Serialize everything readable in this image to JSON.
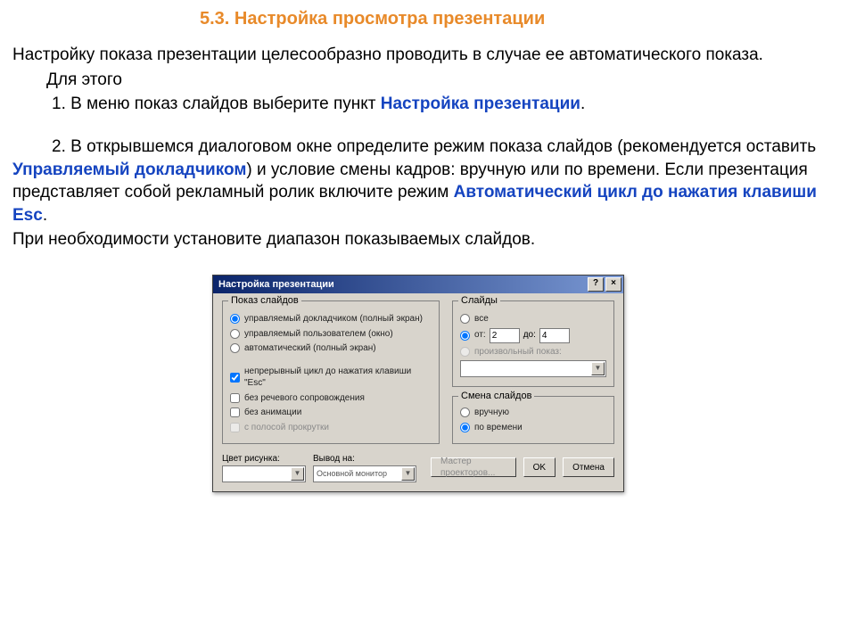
{
  "heading": "5.3.  Настройка просмотра презентации",
  "p1": "Настройку показа презентации целесообразно проводить в случае ее автоматического показа.",
  "p2": "Для этого",
  "p3a": "1.  В меню показ слайдов выберите пункт ",
  "p3term": "Настройка презентации",
  "p3b": ".",
  "p4a": "2.  В открывшемся диалоговом окне определите режим показа слайдов (рекомендуется оставить ",
  "p4term1": "Управляемый докладчиком",
  "p4b": ") и условие смены кадров: вручную или по времени. Если презентация представляет собой рекламный ролик включите режим ",
  "p4term2": "Автоматический цикл до нажатия клавиши Esc",
  "p4c": ".",
  "p5": "При необходимости установите диапазон  показываемых слайдов.",
  "dialog": {
    "title": "Настройка презентации",
    "help": "?",
    "close": "×",
    "group_show": "Показ слайдов",
    "opt1": "управляемый докладчиком (полный экран)",
    "opt2": "управляемый пользователем (окно)",
    "opt3": "автоматический (полный экран)",
    "chk1": "непрерывный цикл до нажатия клавиши \"Esc\"",
    "chk2": "без речевого сопровождения",
    "chk3": "без анимации",
    "chk4": "с полосой прокрутки",
    "group_slides": "Слайды",
    "slides_all": "все",
    "slides_from": "от:",
    "slides_to": "до:",
    "from_val": "2",
    "to_val": "4",
    "slides_custom": "произвольный показ:",
    "group_change": "Смена слайдов",
    "change_manual": "вручную",
    "change_timed": "по времени",
    "color_label": "Цвет рисунка:",
    "output_label": "Вывод на:",
    "output_value": "Основной монитор",
    "btn_proj": "Мастер проекторов...",
    "btn_ok": "OK",
    "btn_cancel": "Отмена"
  }
}
